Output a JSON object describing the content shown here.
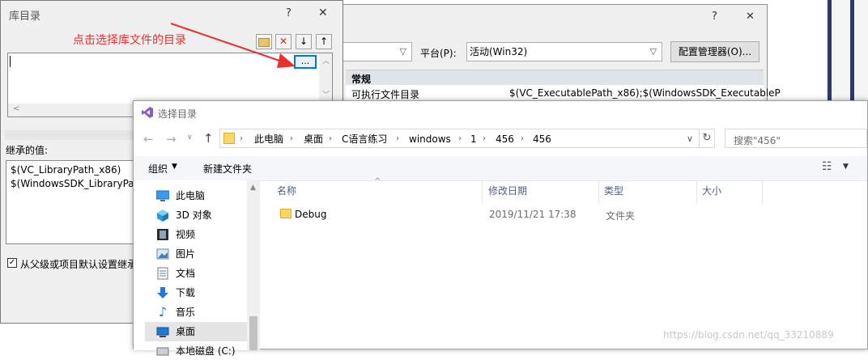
{
  "prop_dialog": {
    "help": "?",
    "close": "✕",
    "platform_label": "平台(P):",
    "platform_value": "活动(Win32)",
    "config_manager": "配置管理器(O)...",
    "section": "常规",
    "row_label": "可执行文件目录",
    "row_value": "$(VC_ExecutablePath_x86);$(WindowsSDK_ExecutableP"
  },
  "lib_dialog": {
    "title": "库目录",
    "help": "?",
    "close": "✕",
    "annotation": "点击选择库文件的目录",
    "browse_btn": "...",
    "inherited_label": "继承的值:",
    "inherited_values": [
      "$(VC_LibraryPath_x86)",
      "$(WindowsSDK_LibraryPath"
    ],
    "inherit_checkbox": "从父级或项目默认设置继承"
  },
  "folder_dialog": {
    "title": "选择目录",
    "breadcrumb": [
      "此电脑",
      "桌面",
      "C语言练习",
      "windows",
      "1",
      "456",
      "456"
    ],
    "search_placeholder": "搜索\"456\"",
    "organize": "组织",
    "new_folder": "新建文件夹",
    "nav": [
      {
        "label": "此电脑",
        "icon": "computer-icon"
      },
      {
        "label": "3D 对象",
        "icon": "cube-icon"
      },
      {
        "label": "视频",
        "icon": "video-icon"
      },
      {
        "label": "图片",
        "icon": "picture-icon"
      },
      {
        "label": "文档",
        "icon": "document-icon"
      },
      {
        "label": "下载",
        "icon": "download-icon"
      },
      {
        "label": "音乐",
        "icon": "music-icon"
      },
      {
        "label": "桌面",
        "icon": "desktop-icon"
      },
      {
        "label": "本地磁盘 (C:)",
        "icon": "disk-icon"
      }
    ],
    "columns": [
      "名称",
      "修改日期",
      "类型",
      "大小"
    ],
    "files": [
      {
        "name": "Debug",
        "date": "2019/11/21 17:38",
        "type": "文件夹",
        "size": ""
      }
    ]
  },
  "watermark": "https://blog.csdn.net/qq_33210889",
  "colors": {
    "annotation": "#e8312e",
    "accent": "#0078d7",
    "selected_nav": "#cce8ff"
  }
}
